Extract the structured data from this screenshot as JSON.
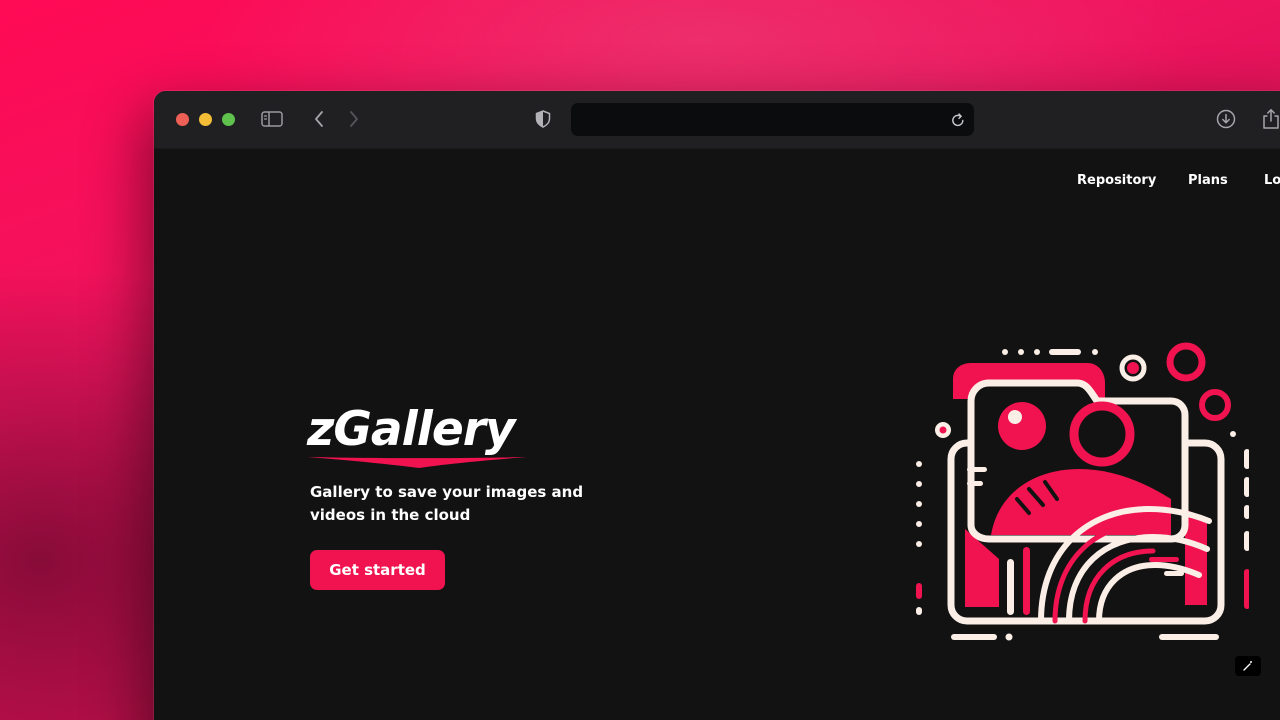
{
  "nav": {
    "repository": "Repository",
    "plans": "Plans",
    "login": "Lo"
  },
  "hero": {
    "brand": "zGallery",
    "tagline": "Gallery to save your images and videos in the cloud",
    "cta": "Get started"
  },
  "colors": {
    "accent": "#f0134f",
    "background": "#121213",
    "toolbar": "#202023",
    "cream": "#fbeee6"
  },
  "icons": {
    "sidebar": "sidebar-icon",
    "back": "chevron-left-icon",
    "forward": "chevron-right-icon",
    "shield": "shield-icon",
    "reload": "reload-icon",
    "download": "download-icon",
    "share": "share-icon",
    "illustration": "gallery-folder-illustration"
  }
}
